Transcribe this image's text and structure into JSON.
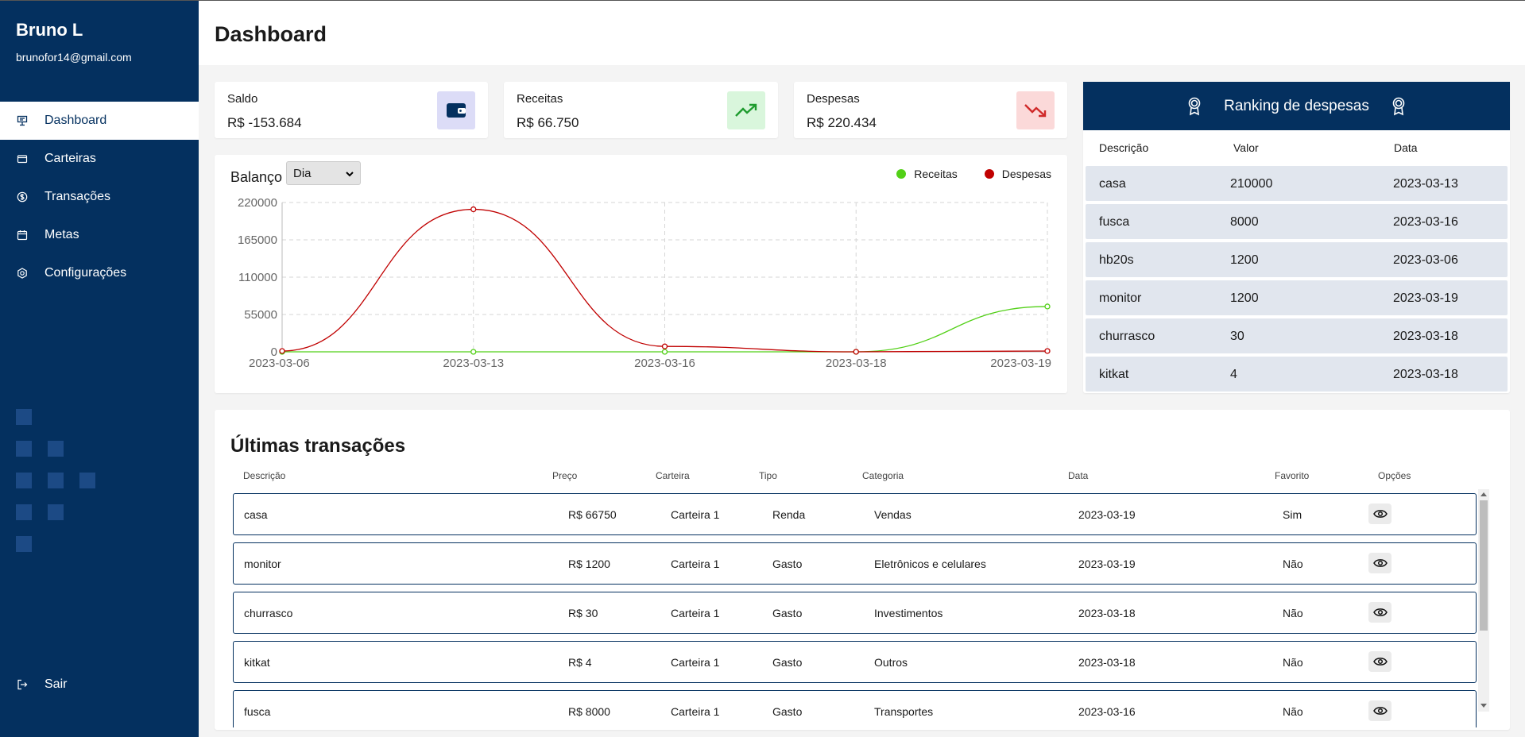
{
  "user": {
    "name": "Bruno L",
    "email": "brunofor14@gmail.com"
  },
  "nav": [
    {
      "label": "Dashboard",
      "icon": "dashboard-icon",
      "active": true
    },
    {
      "label": "Carteiras",
      "icon": "wallet-icon",
      "active": false
    },
    {
      "label": "Transações",
      "icon": "dollar-icon",
      "active": false
    },
    {
      "label": "Metas",
      "icon": "calendar-icon",
      "active": false
    },
    {
      "label": "Configurações",
      "icon": "settings-icon",
      "active": false
    }
  ],
  "logout_label": "Sair",
  "page_title": "Dashboard",
  "stats": {
    "saldo": {
      "label": "Saldo",
      "value": "R$ -153.684",
      "icon": "wallet-icon",
      "color": "#04305f"
    },
    "receitas": {
      "label": "Receitas",
      "value": "R$ 66.750",
      "icon": "trending-up-icon",
      "color": "#1e9b2e"
    },
    "despesas": {
      "label": "Despesas",
      "value": "R$ 220.434",
      "icon": "trending-down-icon",
      "color": "#d02a2a"
    }
  },
  "balance": {
    "title": "Balanço",
    "period_select": "Dia",
    "legend": [
      {
        "name": "Receitas",
        "color": "#52d017"
      },
      {
        "name": "Despesas",
        "color": "#c00000"
      }
    ]
  },
  "chart_data": {
    "type": "line",
    "x": [
      "2023-03-06",
      "2023-03-13",
      "2023-03-16",
      "2023-03-18",
      "2023-03-19"
    ],
    "series": [
      {
        "name": "Receitas",
        "color": "#52d017",
        "values": [
          0,
          0,
          0,
          0,
          66750
        ]
      },
      {
        "name": "Despesas",
        "color": "#c00000",
        "values": [
          1200,
          210000,
          8000,
          34,
          1200
        ]
      }
    ],
    "yticks": [
      0,
      55000,
      110000,
      165000,
      220000
    ],
    "ylim": [
      0,
      220000
    ],
    "grid": true,
    "legend_position": "top-right"
  },
  "ranking": {
    "title": "Ranking de despesas",
    "columns": [
      "Descrição",
      "Valor",
      "Data"
    ],
    "rows": [
      [
        "casa",
        "210000",
        "2023-03-13"
      ],
      [
        "fusca",
        "8000",
        "2023-03-16"
      ],
      [
        "hb20s",
        "1200",
        "2023-03-06"
      ],
      [
        "monitor",
        "1200",
        "2023-03-19"
      ],
      [
        "churrasco",
        "30",
        "2023-03-18"
      ],
      [
        "kitkat",
        "4",
        "2023-03-18"
      ]
    ]
  },
  "transactions": {
    "title": "Últimas transações",
    "columns": [
      "Descrição",
      "Preço",
      "Carteira",
      "Tipo",
      "Categoria",
      "Data",
      "Favorito",
      "Opções"
    ],
    "rows": [
      [
        "casa",
        "R$ 66750",
        "Carteira 1",
        "Renda",
        "Vendas",
        "2023-03-19",
        "Sim"
      ],
      [
        "monitor",
        "R$ 1200",
        "Carteira 1",
        "Gasto",
        "Eletrônicos e celulares",
        "2023-03-19",
        "Não"
      ],
      [
        "churrasco",
        "R$ 30",
        "Carteira 1",
        "Gasto",
        "Investimentos",
        "2023-03-18",
        "Não"
      ],
      [
        "kitkat",
        "R$ 4",
        "Carteira 1",
        "Gasto",
        "Outros",
        "2023-03-18",
        "Não"
      ],
      [
        "fusca",
        "R$ 8000",
        "Carteira 1",
        "Gasto",
        "Transportes",
        "2023-03-16",
        "Não"
      ]
    ]
  }
}
